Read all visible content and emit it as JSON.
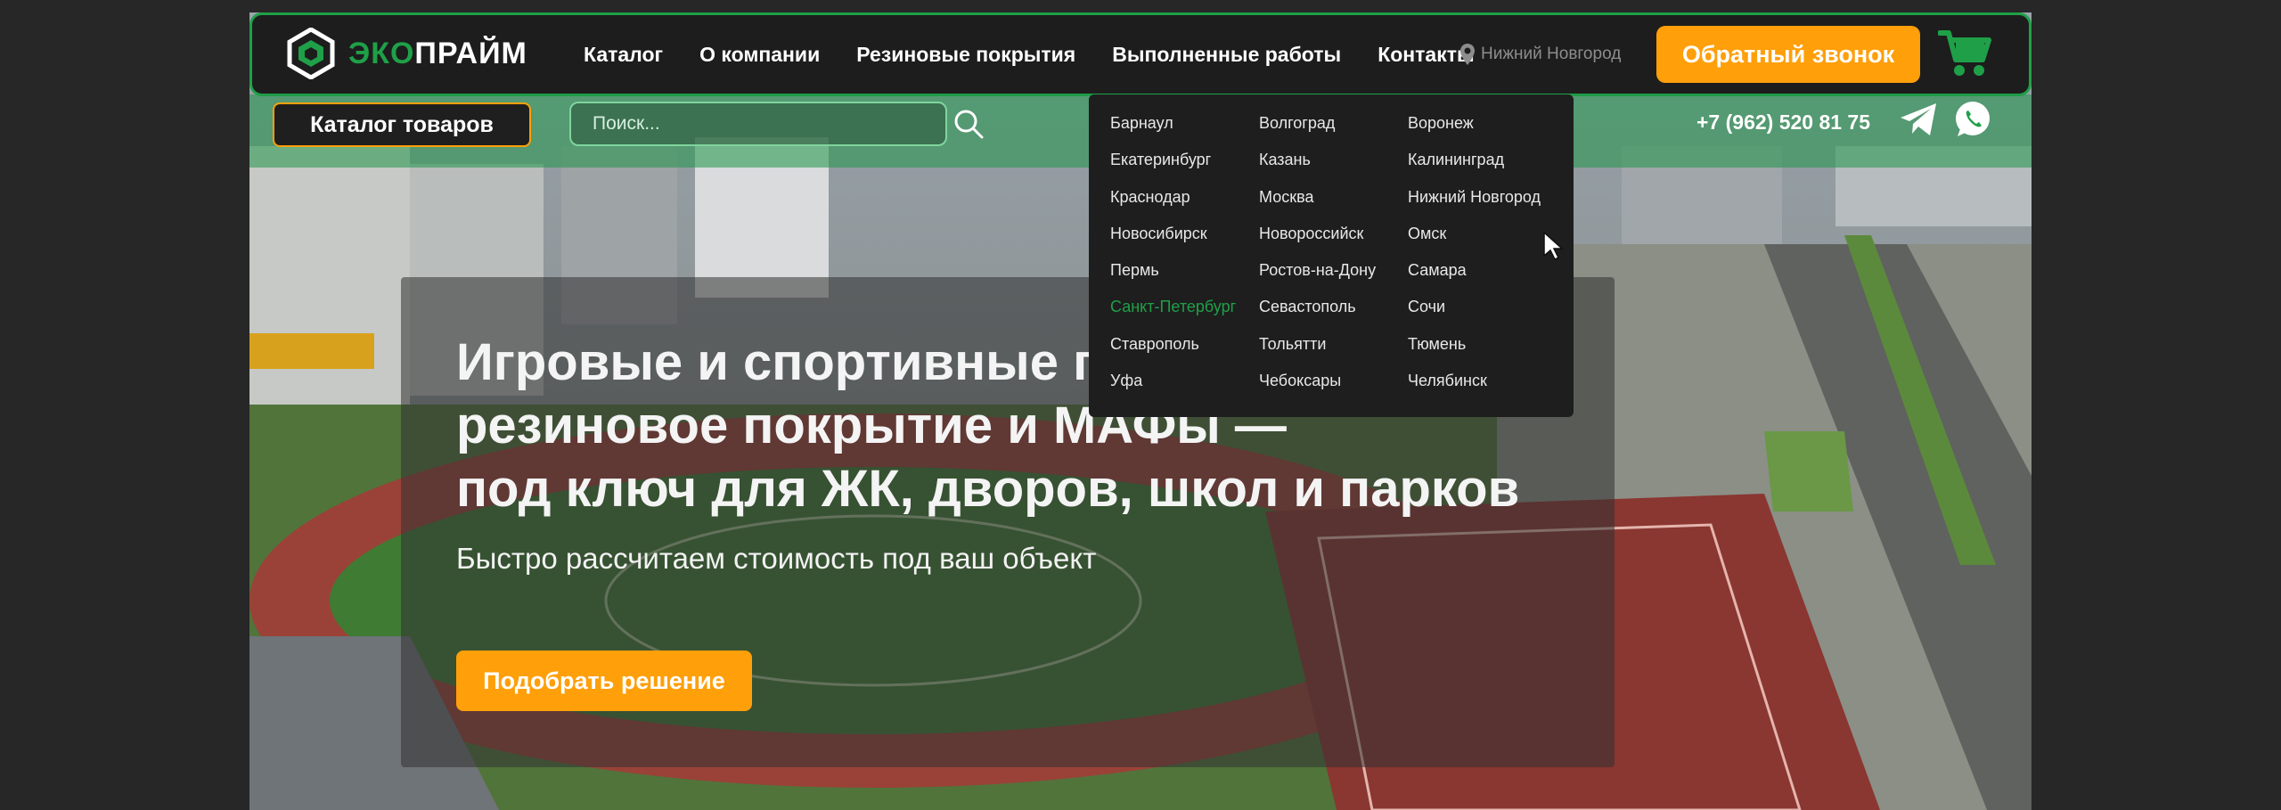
{
  "header": {
    "logo": {
      "eco": "ЭКО",
      "prime": "ПРАЙМ"
    },
    "nav": [
      "Каталог",
      "О компании",
      "Резиновые покрытия",
      "Выполненные работы",
      "Контакты"
    ],
    "city": "Нижний Новгород",
    "callback_label": "Обратный звонок"
  },
  "subbar": {
    "catalog_label": "Каталог товаров",
    "search_placeholder": "Поиск...",
    "phone": "+7 (962) 520 81 75"
  },
  "hero": {
    "headline_1": "Игровые и спортивные п",
    "headline_2": "резиновое покрытие и МАФы —",
    "headline_3": "под ключ для ЖК, дворов, школ и парков",
    "subtitle": "Быстро рассчитаем стоимость под ваш объект",
    "cta_label": "Подобрать решение"
  },
  "cities": [
    "Барнаул",
    "Волгоград",
    "Воронеж",
    "Екатеринбург",
    "Казань",
    "Калининград",
    "Краснодар",
    "Москва",
    "Нижний Новгород",
    "Новосибирск",
    "Новороссийск",
    "Омск",
    "Пермь",
    "Ростов-на-Дону",
    "Самара",
    "Санкт-Петербург",
    "Севастополь",
    "Сочи",
    "Ставрополь",
    "Тольятти",
    "Тюмень",
    "Уфа",
    "Чебоксары",
    "Челябинск"
  ],
  "active_city_index": 15,
  "colors": {
    "accent": "#1fa048",
    "orange": "#ff9f0a",
    "dark": "#1d1d1d"
  },
  "icons": [
    "logo-icon",
    "location-pin-icon",
    "cart-icon",
    "search-icon",
    "telegram-icon",
    "whatsapp-icon",
    "cursor-icon"
  ]
}
